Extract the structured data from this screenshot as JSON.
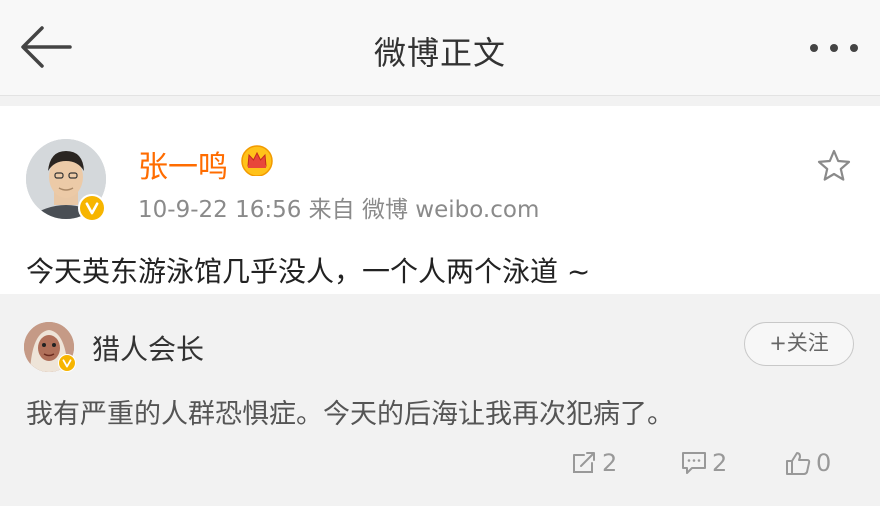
{
  "header": {
    "title": "微博正文",
    "back_icon": "back-arrow-icon",
    "more_icon": "more-dots-icon"
  },
  "post": {
    "author": "张一鸣",
    "author_color": "#ff6c00",
    "badge_icon": "crown-icon",
    "verified_icon": "verified-v-icon",
    "meta": "10-9-22 16:56  来自 微博 weibo.com",
    "favorite_icon": "star-icon",
    "content": "今天英东游泳馆几乎没人，一个人两个泳道 ~"
  },
  "repost": {
    "author": "猎人会长",
    "follow_label": "+关注",
    "content": "我有严重的人群恐惧症。今天的后海让我再次犯病了。",
    "actions": {
      "repost_count": "2",
      "comment_count": "2",
      "like_count": "0"
    }
  }
}
